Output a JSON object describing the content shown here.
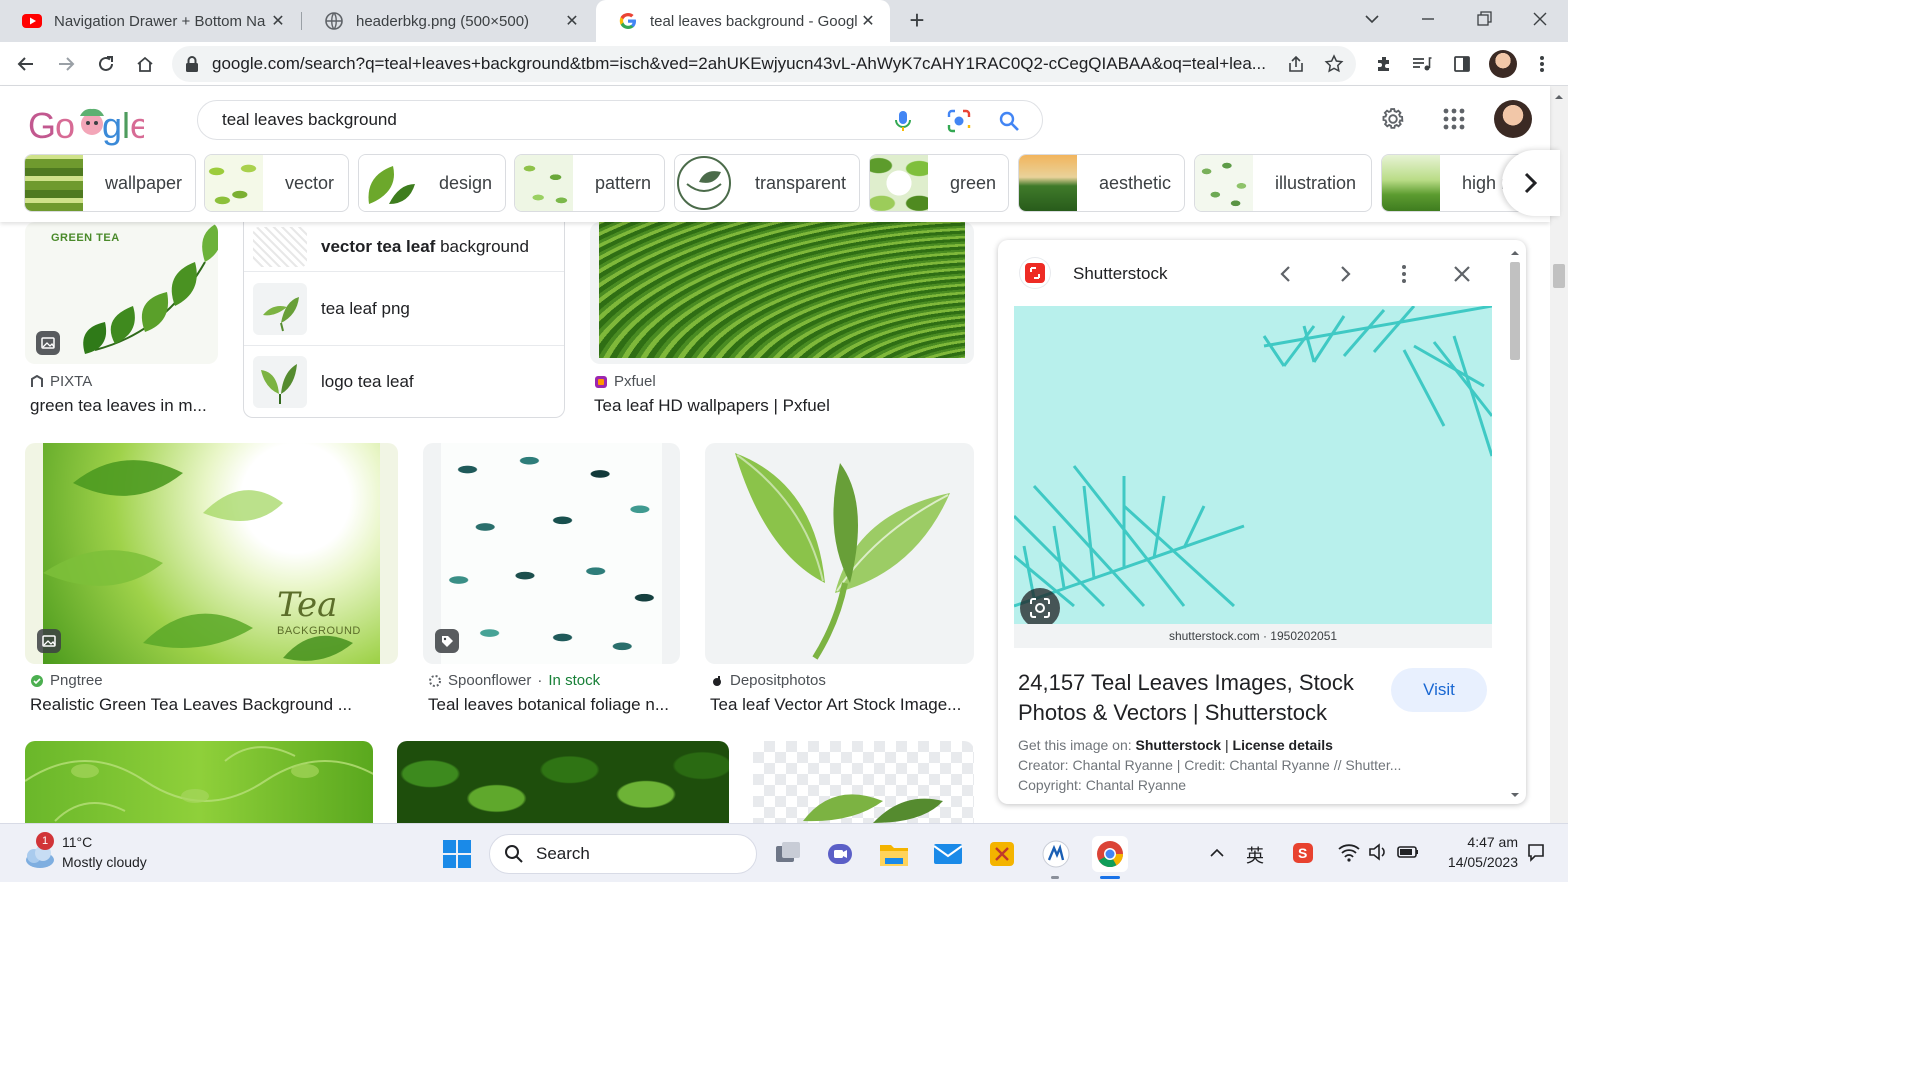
{
  "browser": {
    "tabs": [
      {
        "title": "Navigation Drawer + Bottom Na",
        "favicon": "youtube-icon"
      },
      {
        "title": "headerbkg.png (500×500)",
        "favicon": "globe-icon"
      },
      {
        "title": "teal leaves background - Google",
        "favicon": "google-icon",
        "active": true
      }
    ],
    "url": "google.com/search?q=teal+leaves+background&tbm=isch&ved=2ahUKEwjyucn43vL-AhWyK7cAHY1RAC0Q2-cCegQIABAA&oq=teal+lea..."
  },
  "search": {
    "query": "teal leaves background",
    "chips": [
      "wallpaper",
      "vector",
      "design",
      "pattern",
      "transparent",
      "green",
      "aesthetic",
      "illustration",
      "high re"
    ]
  },
  "related": [
    {
      "bold": "vector tea leaf",
      "rest": " background"
    },
    {
      "bold": "",
      "rest": "tea leaf png"
    },
    {
      "bold": "",
      "rest": "logo tea leaf"
    }
  ],
  "results": [
    {
      "source": "PIXTA",
      "title": "green tea leaves in m...",
      "badge_text": "GREEN TEA"
    },
    {
      "source": "Pxfuel",
      "title": "Tea leaf HD wallpapers | Pxfuel"
    },
    {
      "source": "Pngtree",
      "title": "Realistic Green Tea Leaves Background ...",
      "overlay_big": "Tea",
      "overlay_small": "BACKGROUND"
    },
    {
      "source": "Spoonflower",
      "stock": "In stock",
      "title": "Teal leaves botanical foliage n..."
    },
    {
      "source": "Depositphotos",
      "title": "Tea leaf Vector Art Stock Image..."
    }
  ],
  "panel": {
    "site": "Shutterstock",
    "caption": "shutterstock.com · 1950202051",
    "title_line1": "24,157 Teal Leaves Images, Stock",
    "title_line2": "Photos & Vectors | Shutterstock",
    "visit": "Visit",
    "get_label": "Get this image on: ",
    "get_site": "Shutterstock",
    "license": "License details",
    "creator": "Creator: Chantal Ryanne | Credit: Chantal Ryanne // Shutter...",
    "copyright": "Copyright: Chantal Ryanne"
  },
  "taskbar": {
    "weather_badge": "1",
    "temp": "11°C",
    "condition": "Mostly cloudy",
    "search": "Search",
    "ime": "英",
    "time": "4:47 am",
    "date": "14/05/2023"
  },
  "colors": {
    "accent_blue": "#1a73e8",
    "chrome_tabstrip": "#dee1e6",
    "visit_bg": "#e8f0fe",
    "stock_green": "#188038"
  }
}
